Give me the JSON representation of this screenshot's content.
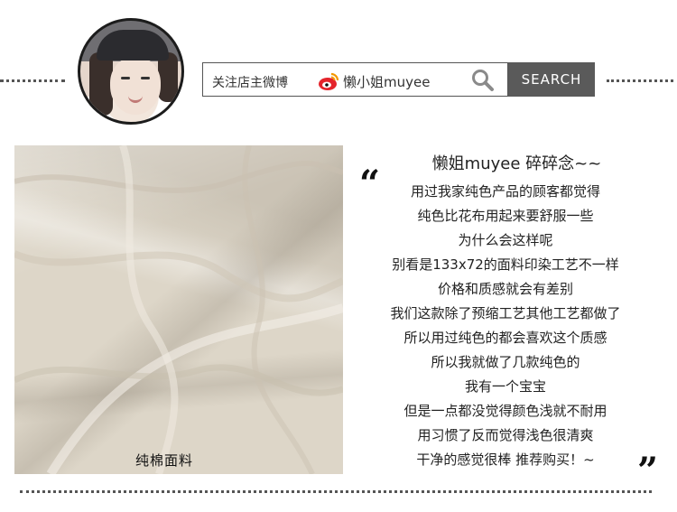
{
  "header": {
    "follow_label": "关注店主微博",
    "weibo_account": "懒小姐muyee",
    "search_button": "SEARCH"
  },
  "icons": {
    "avatar": "avatar",
    "weibo": "weibo-icon",
    "search": "search-icon"
  },
  "photo": {
    "caption": "纯棉面料"
  },
  "blurb": {
    "title": "懒姐muyee 碎碎念~~",
    "lines": [
      "用过我家纯色产品的顾客都觉得",
      "纯色比花布用起来要舒服一些",
      "为什么会这样呢",
      "别看是133x72的面料印染工艺不一样",
      "价格和质感就会有差别",
      "我们这款除了预缩工艺其他工艺都做了",
      "所以用过纯色的都会喜欢这个质感",
      "所以我就做了几款纯色的",
      "我有一个宝宝",
      "但是一点都没觉得颜色浅就不耐用",
      "用习惯了反而觉得浅色很清爽",
      "干净的感觉很棒 推荐购买！~"
    ]
  },
  "colors": {
    "search_button_bg": "#5a5a5a",
    "fabric": "#ddd6c8"
  }
}
